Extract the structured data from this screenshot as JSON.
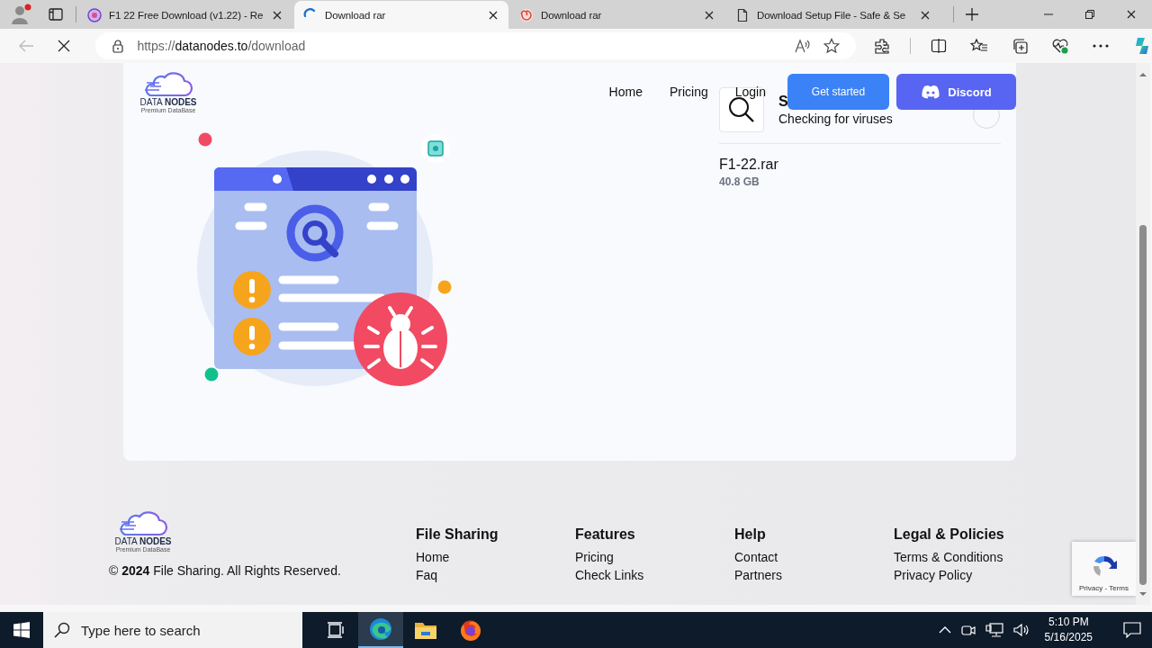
{
  "browser": {
    "tabs": [
      {
        "title": "F1 22 Free Download (v1.22) - Re",
        "kind": "site",
        "selected": false
      },
      {
        "title": "Download rar",
        "kind": "loading",
        "selected": true
      },
      {
        "title": "Download rar",
        "kind": "swirl",
        "selected": false
      },
      {
        "title": "Download Setup File - Safe & Se",
        "kind": "page",
        "selected": false
      }
    ],
    "url": {
      "scheme": "https://",
      "host": "datanodes.to",
      "path": "/download"
    }
  },
  "site": {
    "logo": {
      "name": "DATA **NODES**",
      "tagline": "Premium DataBase"
    },
    "nav": [
      "Home",
      "Pricing",
      "Login"
    ],
    "buttons": [
      {
        "label": "Get started",
        "kind": "primary"
      },
      {
        "label": "Discord",
        "kind": "discord"
      }
    ],
    "scan": {
      "title": "S",
      "status": "Checking for viruses"
    },
    "file": {
      "name": "F1-22.rar",
      "size": "40.8 GB"
    }
  },
  "footer": {
    "logo": {
      "name": "DATA **NODES**",
      "tagline": "Premium DataBase"
    },
    "copyright": "© **2024** File Sharing. All Rights Reserved.",
    "columns": [
      {
        "title": "File Sharing",
        "links": [
          "Home",
          "Faq"
        ]
      },
      {
        "title": "Features",
        "links": [
          "Pricing",
          "Check Links"
        ]
      },
      {
        "title": "Help",
        "links": [
          "Contact",
          "Partners"
        ]
      },
      {
        "title": "Legal & Policies",
        "links": [
          "Terms & Conditions",
          "Privacy Policy"
        ]
      }
    ]
  },
  "recaptcha": {
    "links": "Privacy - Terms"
  },
  "taskbar": {
    "search_placeholder": "Type here to search",
    "apps": [
      {
        "kind": "task-view",
        "active": false
      },
      {
        "kind": "edge",
        "active": true
      },
      {
        "kind": "explorer",
        "active": false
      },
      {
        "kind": "firefox",
        "active": false
      }
    ],
    "time": "5:10 PM",
    "date": "5/16/2025"
  }
}
